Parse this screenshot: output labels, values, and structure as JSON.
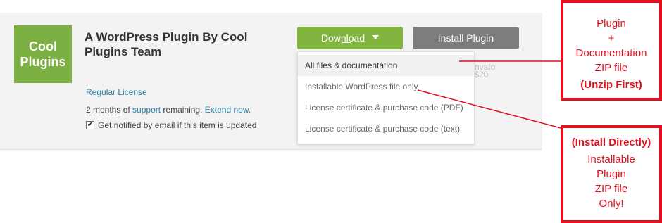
{
  "product": {
    "logo_line1": "Cool",
    "logo_line2": "Plugins",
    "title": "A WordPress Plugin By Cool Plugins Team",
    "license_label": "Regular License",
    "support_period": "2 months",
    "support_of": " of ",
    "support_link": "support",
    "support_remaining": " remaining. ",
    "extend_link": "Extend now.",
    "notify_label": "Get notified by email if this item is updated",
    "notify_checked": true
  },
  "buttons": {
    "download_label": "Download",
    "install_label": "Install Plugin"
  },
  "behind_dropdown": {
    "line1": "Envato",
    "line2": "r $20"
  },
  "dropdown": {
    "items": [
      "All files & documentation",
      "Installable WordPress file only",
      "License certificate & purchase code (PDF)",
      "License certificate & purchase code (text)"
    ]
  },
  "annotations": {
    "top": {
      "line1": "Plugin",
      "line2": "+",
      "line3": "Documentation",
      "line4": "ZIP file",
      "line5": "(Unzip First)"
    },
    "bottom": {
      "line1": "(Install Directly)",
      "line2": "Installable",
      "line3": "Plugin",
      "line4": "ZIP file",
      "line5": "Only!"
    },
    "color": "#e1101f"
  },
  "colors": {
    "download_button": "#82b440",
    "install_button": "#7d7d7d",
    "logo_background": "#7db042",
    "link": "#2a80a8"
  }
}
